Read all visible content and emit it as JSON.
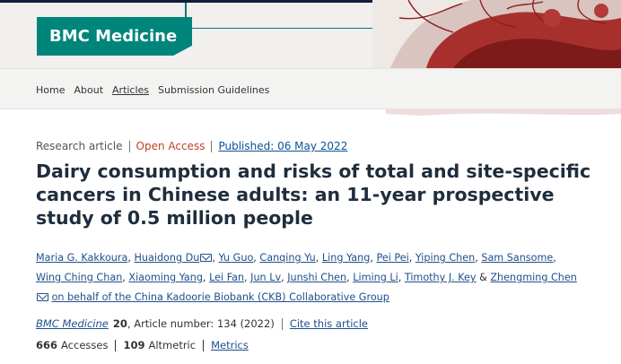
{
  "header": {
    "logo_text": "BMC Medicine"
  },
  "nav": {
    "items": [
      {
        "label": "Home"
      },
      {
        "label": "About"
      },
      {
        "label": "Articles"
      },
      {
        "label": "Submission Guidelines"
      }
    ]
  },
  "article": {
    "type": "Research article",
    "access": "Open Access",
    "published": "Published: 06 May 2022",
    "title": "Dairy consumption and risks of total and site-specific cancers in Chinese adults: an 11-year prospective study of 0.5 million people",
    "authors": [
      "Maria G. Kakkoura",
      "Huaidong Du",
      "Yu Guo",
      "Canqing Yu",
      "Ling Yang",
      "Pei Pei",
      "Yiping Chen",
      "Sam Sansome",
      "Wing Ching Chan",
      "Xiaoming Yang",
      "Lei Fan",
      "Jun Lv",
      "Junshi Chen",
      "Liming Li",
      "Timothy J. Key",
      "Zhengming Chen"
    ],
    "author_and": "&",
    "group": "on behalf of the China Kadoorie Biobank (CKB) Collaborative Group",
    "citation": {
      "journal": "BMC Medicine",
      "volume": "20",
      "rest": ", Article number: 134 (2022)",
      "cite_link": "Cite this article"
    },
    "metrics": {
      "accesses_count": "666",
      "accesses_label": "Accesses",
      "altmetric_count": "109",
      "altmetric_label": "Altmetric",
      "metrics_link": "Metrics"
    }
  },
  "colors": {
    "brand": "#00857a",
    "open_access": "#c0412b",
    "link": "#1f4f8a"
  }
}
